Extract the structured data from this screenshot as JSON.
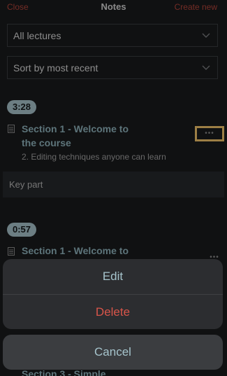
{
  "header": {
    "close_label": "Close",
    "title": "Notes",
    "create_label": "Create new"
  },
  "filters": {
    "lecture_select": "All lectures",
    "sort_select": "Sort by most recent"
  },
  "notes": [
    {
      "time": "3:28",
      "section_line1": "Section 1 - Welcome to",
      "section_line2": "the course",
      "lecture": "2. Editing techniques anyone can learn",
      "content": "Key part",
      "more_label": "•••"
    },
    {
      "time": "0:57",
      "section_line1": "Section 1 - Welcome to",
      "more_label": "•••"
    },
    {
      "section_line1": "Section 3 - Simple"
    }
  ],
  "action_sheet": {
    "edit_label": "Edit",
    "delete_label": "Delete",
    "cancel_label": "Cancel"
  }
}
